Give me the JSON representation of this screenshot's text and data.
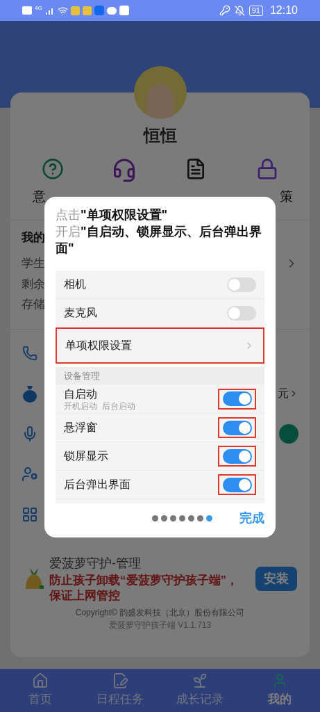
{
  "status_bar": {
    "network": "4G",
    "battery": "91",
    "time": "12:10"
  },
  "profile": {
    "name": "恒恒"
  },
  "shortcuts": {
    "first_label": "意",
    "last_label": "策"
  },
  "my_section": {
    "title": "我的",
    "lines": [
      "学生",
      "剩余",
      "存储"
    ]
  },
  "menu_rows": [
    {
      "kind": "plain"
    },
    {
      "kind": "value",
      "value": "元"
    },
    {
      "kind": "switch",
      "on": true
    },
    {
      "kind": "plain"
    },
    {
      "kind": "plain"
    }
  ],
  "dialog": {
    "instructions": [
      "点击**\"单项权限设置\"**",
      "开启**\"自启动、锁屏显示、后台弹出界面\"**"
    ],
    "permissions": [
      {
        "kind": "toggle",
        "label": "相机",
        "on": false,
        "highlighted": false
      },
      {
        "kind": "toggle",
        "label": "麦克风",
        "on": false,
        "highlighted": false
      },
      {
        "kind": "link",
        "label": "单项权限设置",
        "highlighted": true
      }
    ],
    "device_management": {
      "title": "设备管理",
      "items": [
        {
          "label": "自启动",
          "sub": "开机启动  后台启动",
          "on": true,
          "highlighted": true
        },
        {
          "label": "悬浮窗",
          "on": true,
          "highlighted": true
        },
        {
          "label": "锁屏显示",
          "on": true,
          "highlighted": true
        },
        {
          "label": "后台弹出界面",
          "on": true,
          "highlighted": true
        }
      ]
    },
    "pages": [
      {
        "selected": false
      },
      {
        "selected": false
      },
      {
        "selected": false
      },
      {
        "selected": false
      },
      {
        "selected": false
      },
      {
        "selected": false
      },
      {
        "selected": true
      }
    ],
    "done_button": "完成"
  },
  "promo": {
    "title": "爱菠萝守护-管理",
    "message": "防止孩子卸载“爱菠萝守护孩子端”，保证上网管控",
    "button": "安装"
  },
  "footer": {
    "copyright": "Copyright© 韵盛发科技（北京）股份有限公司",
    "version": "爱菠萝守护孩子端 V1.1.713"
  },
  "tab_bar": [
    {
      "label": "首页",
      "selected": false
    },
    {
      "label": "日程任务",
      "selected": false
    },
    {
      "label": "成长记录",
      "selected": false
    },
    {
      "label": "我的",
      "selected": true
    }
  ]
}
